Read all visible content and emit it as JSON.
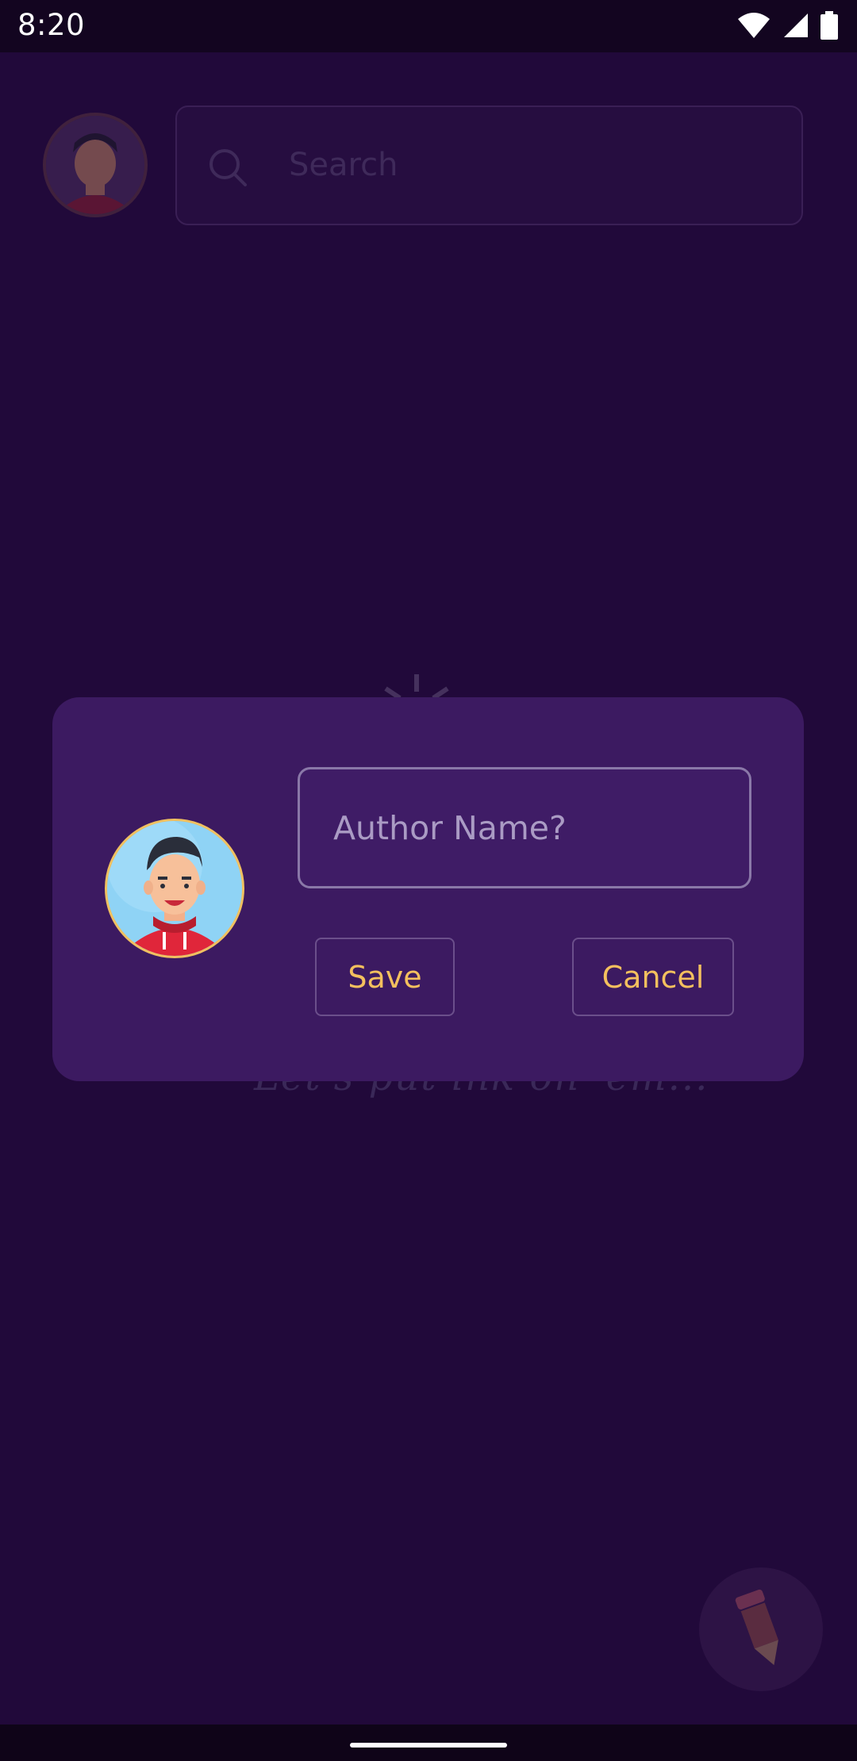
{
  "status_bar": {
    "time": "8:20",
    "icons": [
      "wifi-icon",
      "signal-icon",
      "battery-icon"
    ]
  },
  "header": {
    "avatar": "avatar-icon",
    "search_placeholder": "Search"
  },
  "empty_state": {
    "tagline": "Let's put ink on 'em..."
  },
  "dialog": {
    "avatar": "avatar-icon",
    "author_input": {
      "value": "",
      "placeholder": "Author Name?"
    },
    "save_label": "Save",
    "cancel_label": "Cancel"
  },
  "fab": {
    "icon": "pencil-icon"
  },
  "colors": {
    "background": "#21093a",
    "dialog": "#3c1a61",
    "accent": "#f4c05e"
  }
}
